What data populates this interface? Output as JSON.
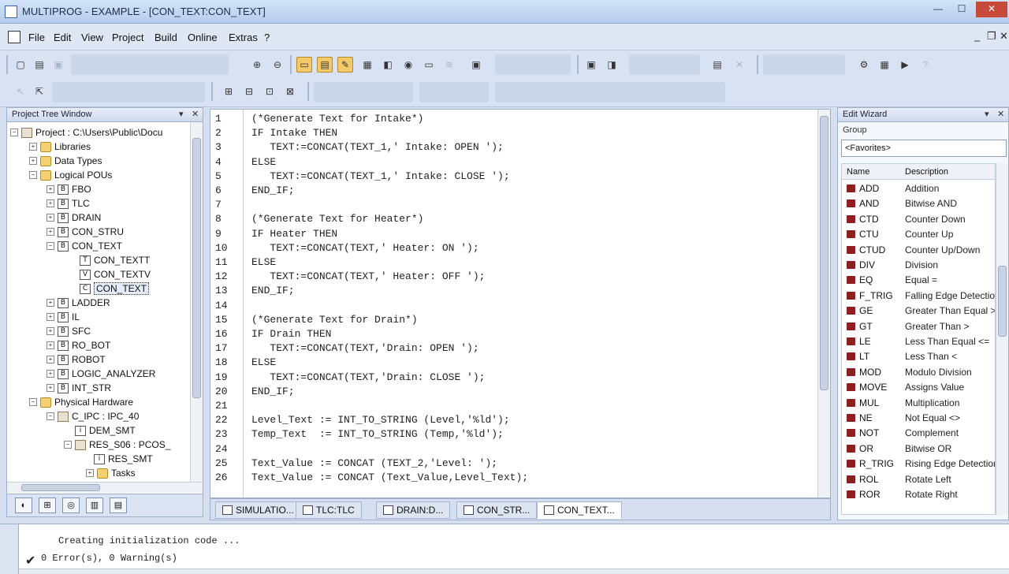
{
  "window": {
    "title": "MULTIPROG - EXAMPLE - [CON_TEXT:CON_TEXT]",
    "minimize": "—",
    "maximize": "☐",
    "close": "✕"
  },
  "menu": {
    "items": [
      "File",
      "Edit",
      "View",
      "Project",
      "Build",
      "Online",
      "Extras",
      "?"
    ],
    "right_min": "_",
    "right_restore": "❐",
    "right_close": "✕"
  },
  "tree": {
    "header": "Project Tree Window",
    "items": [
      {
        "label": "Project : C:\\Users\\Public\\Docu",
        "icon": "project-icon",
        "glyph": "P"
      },
      {
        "label": "Libraries",
        "icon": "folder-icon",
        "glyph": ""
      },
      {
        "label": "Data Types",
        "icon": "folder-icon",
        "glyph": ""
      },
      {
        "label": "Logical POUs",
        "icon": "folder-icon",
        "glyph": ""
      },
      {
        "label": "FBO",
        "icon": "pou-icon",
        "glyph": "B"
      },
      {
        "label": "TLC",
        "icon": "pou-icon",
        "glyph": "B"
      },
      {
        "label": "DRAIN",
        "icon": "pou-icon",
        "glyph": "B"
      },
      {
        "label": "CON_STRU",
        "icon": "pou-icon",
        "glyph": "B"
      },
      {
        "label": "CON_TEXT",
        "icon": "pou-icon",
        "glyph": "B"
      },
      {
        "label": "CON_TEXTT",
        "icon": "doc-icon",
        "glyph": "T"
      },
      {
        "label": "CON_TEXTV",
        "icon": "doc-icon",
        "glyph": "V"
      },
      {
        "label": "CON_TEXT",
        "icon": "doc-icon",
        "glyph": "C"
      },
      {
        "label": "LADDER",
        "icon": "pou-icon",
        "glyph": "B"
      },
      {
        "label": "IL",
        "icon": "pou-icon",
        "glyph": "B"
      },
      {
        "label": "SFC",
        "icon": "pou-icon",
        "glyph": "B"
      },
      {
        "label": "RO_BOT",
        "icon": "pou-icon",
        "glyph": "B"
      },
      {
        "label": "ROBOT",
        "icon": "pou-icon",
        "glyph": "B"
      },
      {
        "label": "LOGIC_ANALYZER",
        "icon": "pou-icon",
        "glyph": "B"
      },
      {
        "label": "INT_STR",
        "icon": "pou-icon",
        "glyph": "B"
      },
      {
        "label": "Physical Hardware",
        "icon": "folder-icon",
        "glyph": ""
      },
      {
        "label": "C_IPC : IPC_40",
        "icon": "pc-icon",
        "glyph": ""
      },
      {
        "label": "DEM_SMT",
        "icon": "doc-icon",
        "glyph": "i"
      },
      {
        "label": "RES_S06 : PCOS_",
        "icon": "pc-icon",
        "glyph": ""
      },
      {
        "label": "RES_SMT",
        "icon": "doc-icon",
        "glyph": "i"
      },
      {
        "label": "Tasks",
        "icon": "folder-icon",
        "glyph": ""
      }
    ]
  },
  "editor": {
    "lines": [
      {
        "n": "1",
        "code": "(*Generate Text for Intake*)"
      },
      {
        "n": "2",
        "code": "IF Intake THEN"
      },
      {
        "n": "3",
        "code": "   TEXT:=CONCAT(TEXT_1,' Intake: OPEN ');"
      },
      {
        "n": "4",
        "code": "ELSE"
      },
      {
        "n": "5",
        "code": "   TEXT:=CONCAT(TEXT_1,' Intake: CLOSE ');"
      },
      {
        "n": "6",
        "code": "END_IF;"
      },
      {
        "n": "7",
        "code": ""
      },
      {
        "n": "8",
        "code": "(*Generate Text for Heater*)"
      },
      {
        "n": "9",
        "code": "IF Heater THEN"
      },
      {
        "n": "10",
        "code": "   TEXT:=CONCAT(TEXT,' Heater: ON ');"
      },
      {
        "n": "11",
        "code": "ELSE"
      },
      {
        "n": "12",
        "code": "   TEXT:=CONCAT(TEXT,' Heater: OFF ');"
      },
      {
        "n": "13",
        "code": "END_IF;"
      },
      {
        "n": "14",
        "code": ""
      },
      {
        "n": "15",
        "code": "(*Generate Text for Drain*)"
      },
      {
        "n": "16",
        "code": "IF Drain THEN"
      },
      {
        "n": "17",
        "code": "   TEXT:=CONCAT(TEXT,'Drain: OPEN ');"
      },
      {
        "n": "18",
        "code": "ELSE"
      },
      {
        "n": "19",
        "code": "   TEXT:=CONCAT(TEXT,'Drain: CLOSE ');"
      },
      {
        "n": "20",
        "code": "END_IF;"
      },
      {
        "n": "21",
        "code": ""
      },
      {
        "n": "22",
        "code": "Level_Text := INT_TO_STRING (Level,'%ld');"
      },
      {
        "n": "23",
        "code": "Temp_Text  := INT_TO_STRING (Temp,'%ld');"
      },
      {
        "n": "24",
        "code": ""
      },
      {
        "n": "25",
        "code": "Text_Value := CONCAT (TEXT_2,'Level: ');"
      },
      {
        "n": "26",
        "code": "Text_Value := CONCAT (Text_Value,Level_Text);"
      }
    ],
    "tabs": [
      "SIMULATIO...",
      "TLC:TLC",
      "DRAIN:D...",
      "CON_STR...",
      "CON_TEXT..."
    ]
  },
  "wizard": {
    "header": "Edit Wizard",
    "group_label": "Group",
    "group_value": "<Favorites>",
    "col_name": "Name",
    "col_desc": "Description",
    "rows": [
      {
        "name": "ADD",
        "desc": "Addition"
      },
      {
        "name": "AND",
        "desc": "Bitwise AND"
      },
      {
        "name": "CTD",
        "desc": "Counter Down"
      },
      {
        "name": "CTU",
        "desc": "Counter Up"
      },
      {
        "name": "CTUD",
        "desc": "Counter Up/Down"
      },
      {
        "name": "DIV",
        "desc": "Division"
      },
      {
        "name": "EQ",
        "desc": "Equal ="
      },
      {
        "name": "F_TRIG",
        "desc": "Falling Edge Detection"
      },
      {
        "name": "GE",
        "desc": "Greater Than Equal >="
      },
      {
        "name": "GT",
        "desc": "Greater Than >"
      },
      {
        "name": "LE",
        "desc": "Less Than Equal <="
      },
      {
        "name": "LT",
        "desc": "Less Than <"
      },
      {
        "name": "MOD",
        "desc": "Modulo Division"
      },
      {
        "name": "MOVE",
        "desc": "Assigns Value"
      },
      {
        "name": "MUL",
        "desc": "Multiplication"
      },
      {
        "name": "NE",
        "desc": "Not Equal <>"
      },
      {
        "name": "NOT",
        "desc": "Complement"
      },
      {
        "name": "OR",
        "desc": "Bitwise OR"
      },
      {
        "name": "R_TRIG",
        "desc": "Rising Edge Detection"
      },
      {
        "name": "ROL",
        "desc": "Rotate Left"
      },
      {
        "name": "ROR",
        "desc": "Rotate Right"
      }
    ]
  },
  "output": {
    "line1": "Creating initialization code ...",
    "line2": "0 Error(s), 0 Warning(s)"
  }
}
